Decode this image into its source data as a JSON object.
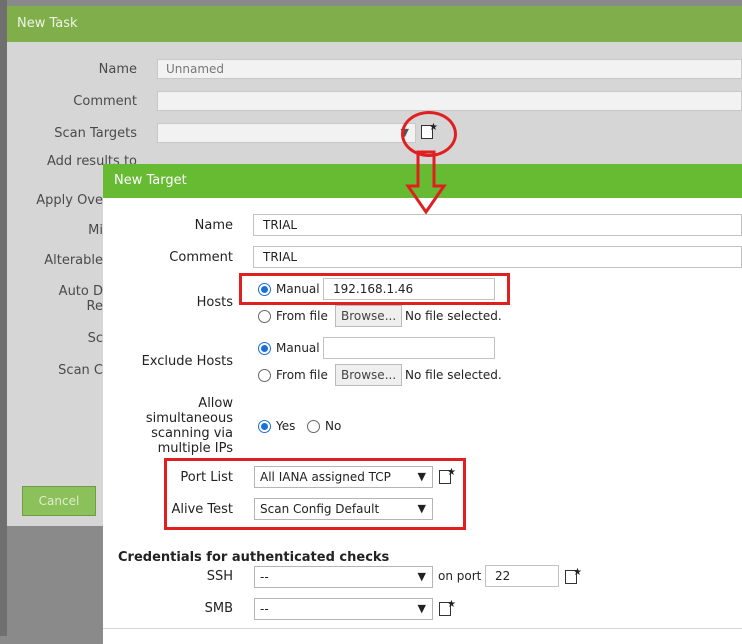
{
  "task_dialog": {
    "title": "New Task",
    "labels": {
      "name": "Name",
      "comment": "Comment",
      "scan_targets": "Scan Targets",
      "add_results": "Add results to",
      "add_results_2": "A",
      "apply_overrides": "Apply Ove",
      "min_qod": "Mi",
      "alterable": "Alterable",
      "auto_delete": "Auto D",
      "auto_delete_2": "Re",
      "scanner": "Sc",
      "scan_config": "Scan C"
    },
    "name_value": "Unnamed",
    "comment_value": "",
    "cancel_label": "Cancel"
  },
  "target_dialog": {
    "title": "New Target",
    "labels": {
      "name": "Name",
      "comment": "Comment",
      "hosts": "Hosts",
      "exclude_hosts": "Exclude Hosts",
      "allow_1": "Allow",
      "allow_2": "simultaneous",
      "allow_3": "scanning via",
      "allow_4": "multiple IPs",
      "port_list": "Port List",
      "alive_test": "Alive Test",
      "credentials": "Credentials for authenticated checks",
      "ssh": "SSH",
      "smb": "SMB",
      "on_port": "on port"
    },
    "name_value": "TRIAL",
    "comment_value": "TRIAL",
    "hosts": {
      "manual_label": "Manual",
      "manual_value": "192.168.1.46",
      "from_file_label": "From file",
      "browse_label": "Browse...",
      "no_file": "No file selected."
    },
    "exclude_hosts": {
      "manual_label": "Manual",
      "manual_value": "",
      "from_file_label": "From file",
      "browse_label": "Browse...",
      "no_file": "No file selected."
    },
    "allow_yes": "Yes",
    "allow_no": "No",
    "port_list_value": "All IANA assigned TCP",
    "alive_test_value": "Scan Config Default",
    "ssh_value": "--",
    "ssh_port": "22",
    "smb_value": "--",
    "arrow_glyph": "▼"
  },
  "colors": {
    "header_green": "#66bb33",
    "annotation_red": "#e02020",
    "radio_blue": "#1b6fd6"
  }
}
